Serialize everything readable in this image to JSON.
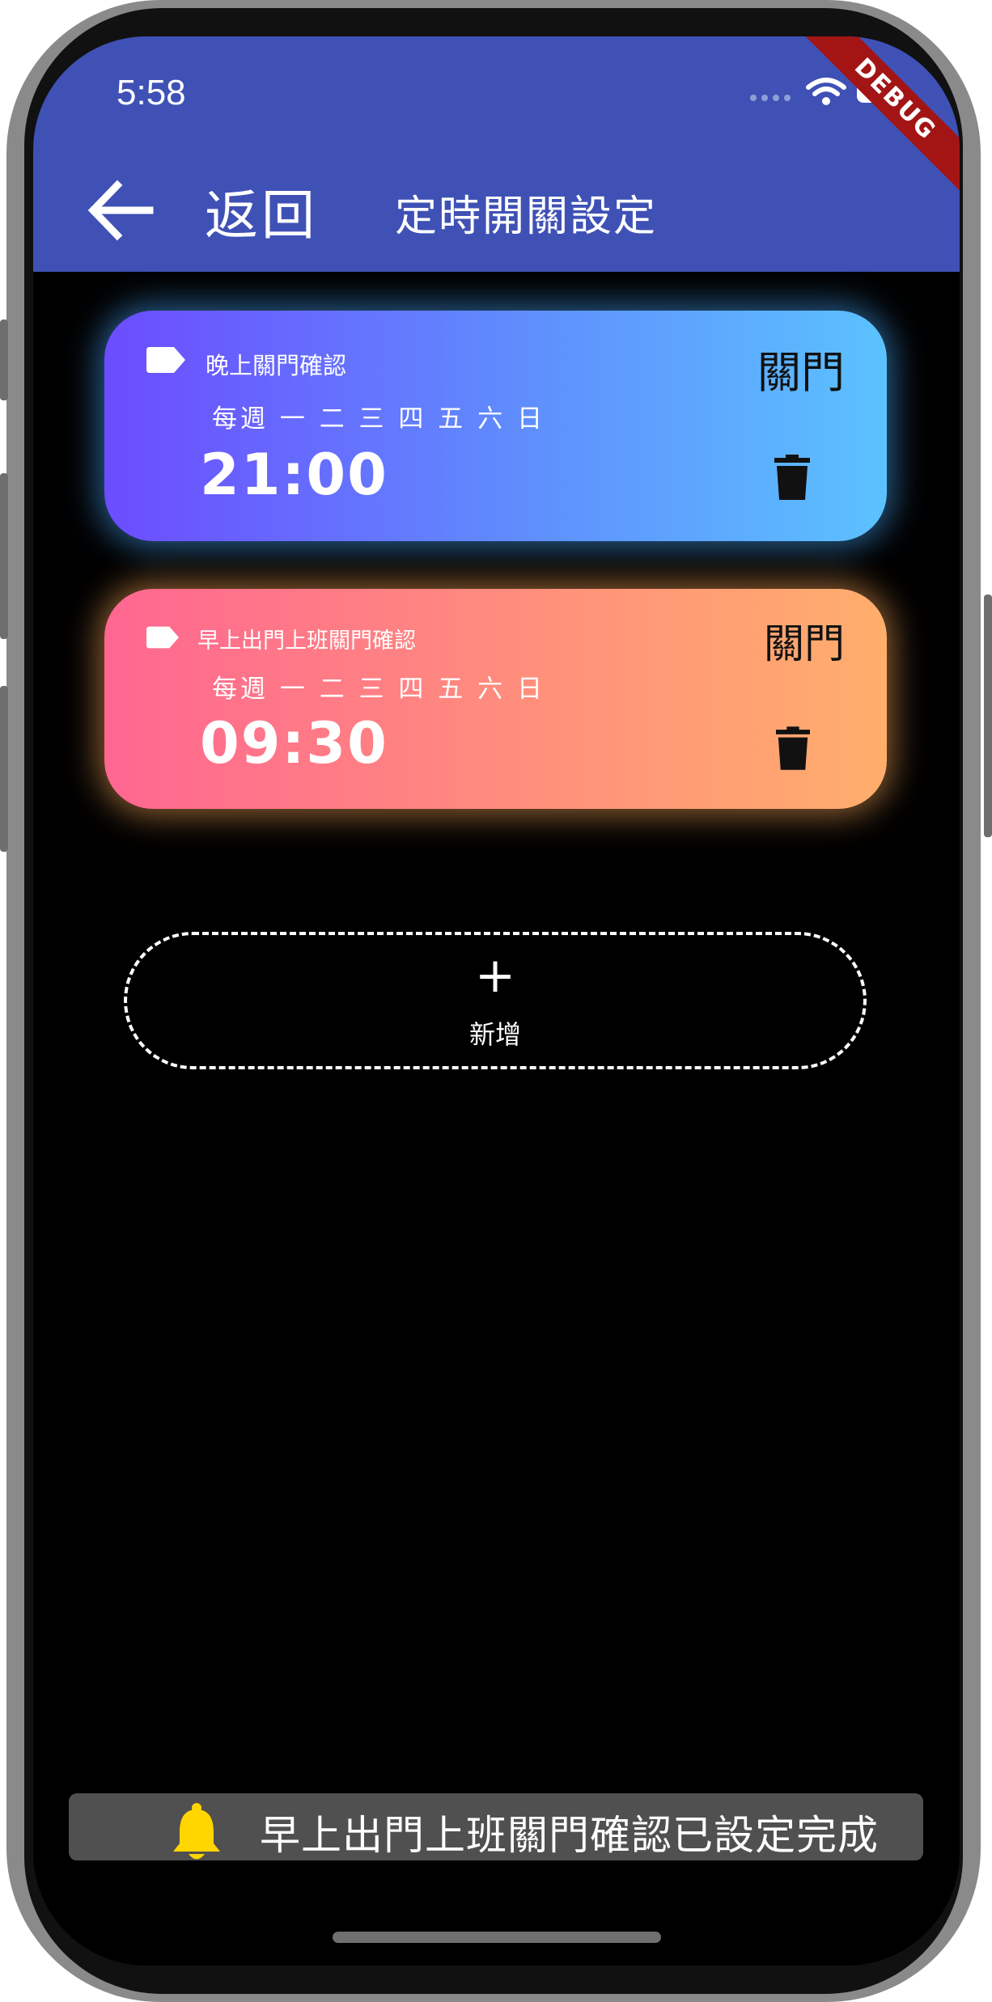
{
  "status_bar": {
    "time": "5:58",
    "debug_label": "DEBUG"
  },
  "app_bar": {
    "back_label": "返回",
    "title": "定時開關設定",
    "color": "#3f51b5"
  },
  "schedules": [
    {
      "label": "晚上關門確認",
      "action": "關門",
      "days": "每週 一 二 三 四 五 六 日",
      "time": "21:00",
      "gradient": [
        "#6c4cff",
        "#5bc2fe"
      ]
    },
    {
      "label": "早上出門上班關門確認",
      "action": "關門",
      "days": "每週 一 二 三 四 五 六 日",
      "time": "09:30",
      "gradient": [
        "#ff6691",
        "#ffae6c"
      ]
    }
  ],
  "add_button": {
    "icon": "+",
    "label": "新增"
  },
  "toast": {
    "icon": "bell-icon",
    "text": "早上出門上班關門確認已設定完成",
    "icon_color": "#ffd600"
  }
}
